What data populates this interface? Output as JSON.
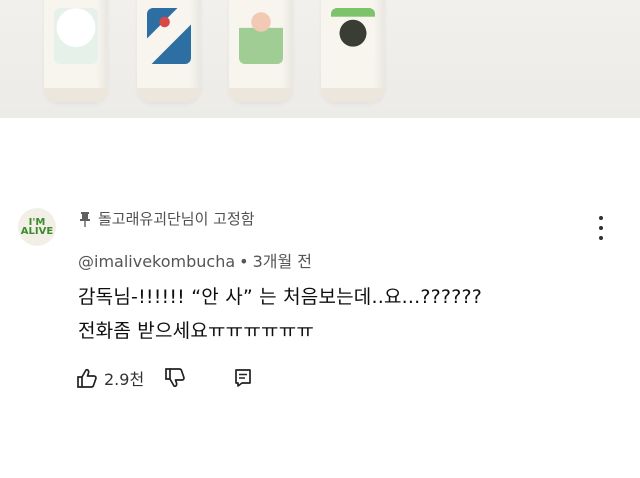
{
  "comment": {
    "pinned_label": "돌고래유괴단님이 고정함",
    "author": "@imalivekombucha",
    "separator": "•",
    "time": "3개월 전",
    "text_line1": "감독님-!!!!!!  “안 사” 는 처음보는데..요...??????",
    "text_line2": "전화좀 받으세요ㅠㅠㅠㅠㅠㅠ",
    "like_count": "2.9천",
    "avatar_text": "I'M ALIVE"
  },
  "colors": {
    "accent_green": "#3d8b2e",
    "text_primary": "#0f0f0f",
    "text_secondary": "#555555"
  },
  "icons": [
    "pin-icon",
    "more-vert-icon",
    "thumb-up-icon",
    "thumb-down-icon",
    "reply-icon"
  ]
}
